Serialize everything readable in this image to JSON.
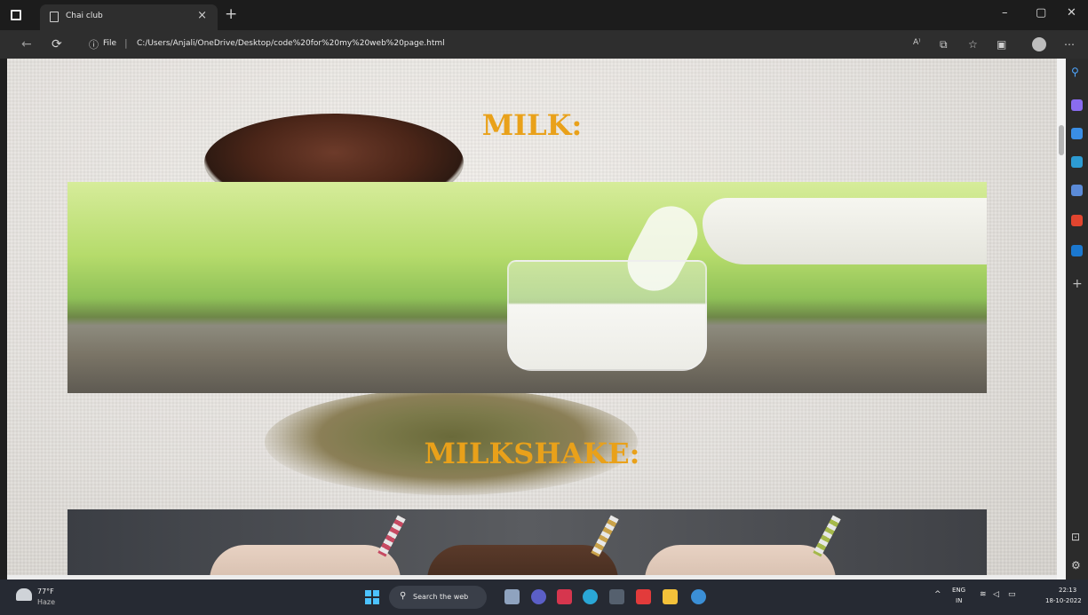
{
  "browser": {
    "tab_title": "Chai club",
    "tab_close": "×",
    "new_tab": "+",
    "window_controls": {
      "minimize": "–",
      "maximize": "▢",
      "close": "✕"
    },
    "address": {
      "info_icon": "ⓘ",
      "scheme_label": "File",
      "separator": "|",
      "url": "C:/Users/Anjali/OneDrive/Desktop/code%20for%20my%20web%20page.html"
    },
    "toolbar_icons": [
      "read-aloud-icon",
      "collections-icon",
      "favorites-icon",
      "split-screen-icon",
      "profile-icon",
      "more-icon"
    ]
  },
  "page": {
    "sections": [
      {
        "title": "MILK:"
      },
      {
        "title": "MILKSHAKE:"
      }
    ]
  },
  "sidebar": {
    "icons": [
      "search-icon",
      "sparkle-icon",
      "tag-icon",
      "briefcase-icon",
      "people-icon",
      "office-icon",
      "outlook-icon",
      "add-icon",
      "layout-icon",
      "settings-icon"
    ]
  },
  "taskbar": {
    "weather": {
      "temp": "77°F",
      "condition": "Haze"
    },
    "search_label": "Search the web",
    "language": {
      "line1": "ENG",
      "line2": "IN"
    },
    "clock": {
      "time": "22:13",
      "date": "18-10-2022"
    }
  },
  "colors": {
    "heading": "#e9a11a",
    "taskbar": "#262a33",
    "browser_chrome": "#2e2e2e"
  }
}
